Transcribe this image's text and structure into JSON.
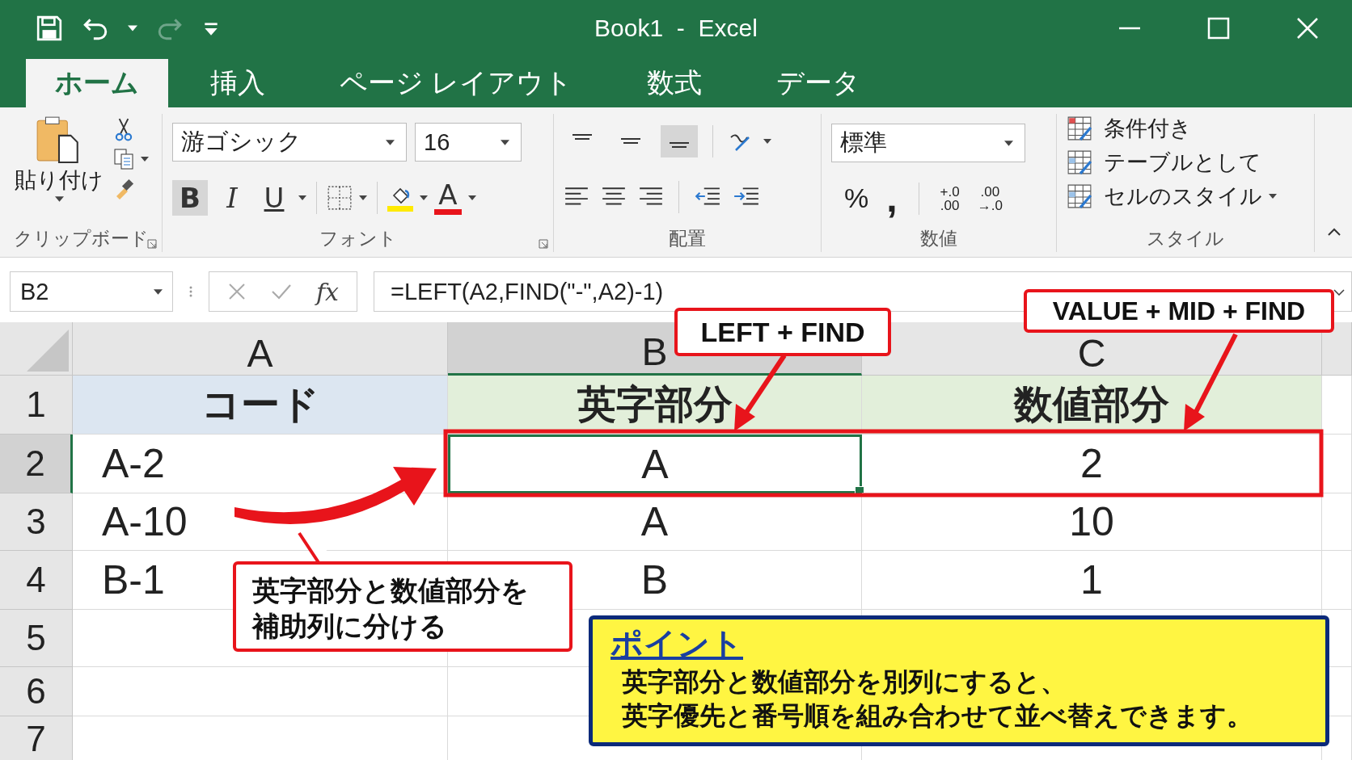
{
  "title_bar": {
    "title": "Book1  -  Excel"
  },
  "tabs": [
    {
      "label": "ホーム",
      "selected": true
    },
    {
      "label": "挿入",
      "selected": false
    },
    {
      "label": "ページ レイアウト",
      "selected": false
    },
    {
      "label": "数式",
      "selected": false
    },
    {
      "label": "データ",
      "selected": false
    }
  ],
  "ribbon": {
    "clipboard": {
      "paste": "貼り付け",
      "label": "クリップボード"
    },
    "font": {
      "name": "游ゴシック",
      "size": "16",
      "label": "フォント",
      "buttons": [
        {
          "label": "B",
          "kind": "bold",
          "selected": true
        },
        {
          "label": "I",
          "kind": "italic",
          "selected": false
        },
        {
          "label": "U",
          "kind": "underline",
          "selected": false
        }
      ],
      "font_color": "A"
    },
    "alignment": {
      "label": "配置",
      "vertical": [
        {
          "selected": false
        },
        {
          "selected": false
        },
        {
          "selected": true
        }
      ]
    },
    "number": {
      "format": "標準",
      "percent": "%",
      "comma": ",",
      "increase_decimal": [
        "+.0",
        ".00"
      ],
      "decrease_decimal": [
        ".00",
        "→.0"
      ],
      "label": "数値"
    },
    "styles": {
      "label": "スタイル",
      "items": [
        {
          "label": "条件付き",
          "dropdown": false
        },
        {
          "label": "テーブルとして",
          "dropdown": false
        },
        {
          "label": "セルのスタイル",
          "dropdown": true
        }
      ]
    }
  },
  "formula_bar": {
    "name_box": "B2",
    "fx": "fx",
    "formula": "=LEFT(A2,FIND(\"-\",A2)-1)"
  },
  "sheet": {
    "columns": [
      {
        "label": "A",
        "selected": false
      },
      {
        "label": "B",
        "selected": true
      },
      {
        "label": "C",
        "selected": false
      }
    ],
    "rows": [
      {
        "label": "1",
        "selected": false,
        "kind": "header",
        "cells": [
          {
            "text": "コード",
            "color": "#dce6f1",
            "selected": false
          },
          {
            "text": "英字部分",
            "color": "#e2efda",
            "selected": false
          },
          {
            "text": "数値部分",
            "color": "#e2efda",
            "selected": false
          }
        ]
      },
      {
        "label": "2",
        "selected": true,
        "kind": "data",
        "cells": [
          {
            "text": "A-2",
            "selected": false
          },
          {
            "text": "A",
            "selected": true
          },
          {
            "text": "2",
            "selected": false
          }
        ]
      },
      {
        "label": "3",
        "selected": false,
        "kind": "data",
        "cells": [
          {
            "text": "A-10",
            "selected": false
          },
          {
            "text": "A",
            "selected": false
          },
          {
            "text": "10",
            "selected": false
          }
        ]
      },
      {
        "label": "4",
        "selected": false,
        "kind": "data",
        "cells": [
          {
            "text": "B-1",
            "selected": false
          },
          {
            "text": "B",
            "selected": false
          },
          {
            "text": "1",
            "selected": false
          }
        ]
      },
      {
        "label": "5",
        "selected": false,
        "cells": []
      },
      {
        "label": "6",
        "selected": false,
        "cells": []
      },
      {
        "label": "7",
        "selected": false,
        "cells": []
      }
    ]
  },
  "annotations": {
    "callouts": [
      {
        "text": "LEFT + FIND"
      },
      {
        "text": "VALUE + MID + FIND"
      },
      {
        "text": "英字部分と数値部分を補助列に分ける"
      }
    ],
    "point": {
      "title": "ポイント",
      "lines": [
        "英字部分と数値部分を別列にすると、",
        "英字優先と番号順を組み合わせて並べ替えできます。"
      ]
    }
  }
}
